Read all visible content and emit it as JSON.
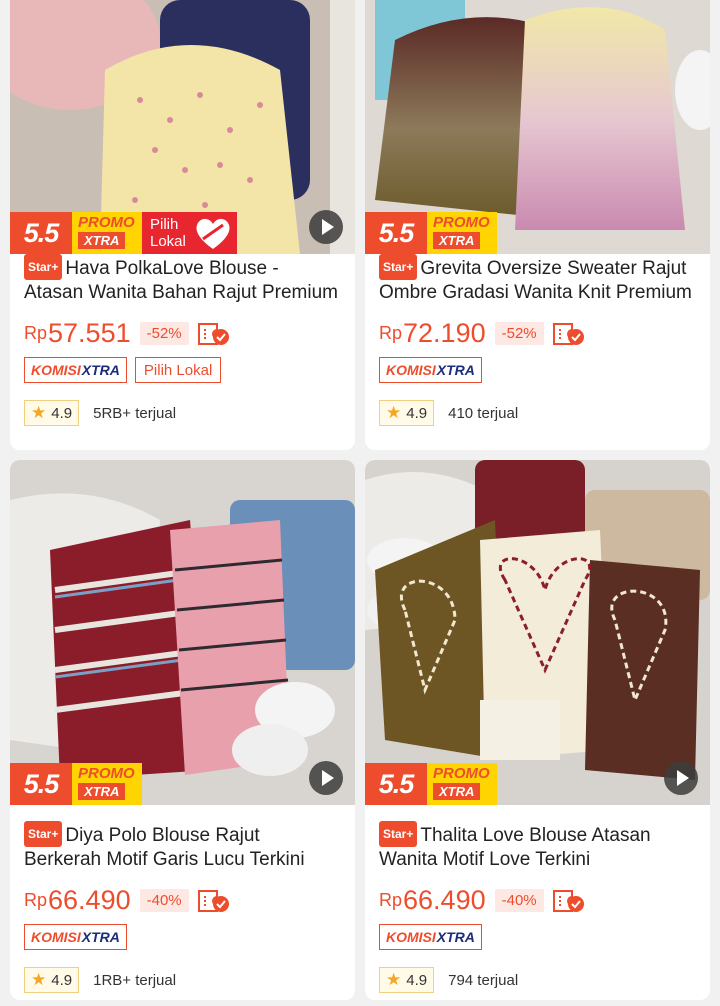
{
  "colors": {
    "accent": "#ee4d2d",
    "promo_yellow": "#ffd400",
    "komisi_blue": "#1b2d7a"
  },
  "products": [
    {
      "badge_55": "5.5",
      "promo_top": "PROMO",
      "promo_bottom": "XTRA",
      "lokal_badge_line1": "Pilih",
      "lokal_badge_line2": "Lokal",
      "star_tag": "Star+",
      "title": "Hava PolkaLove Blouse - Atasan Wanita Bahan Rajut Premium",
      "currency": "Rp",
      "price": "57.551",
      "discount": "-52%",
      "komisi_a": "KOMISI",
      "komisi_b": "XTRA",
      "lokal_tag": "Pilih Lokal",
      "rating": "4.9",
      "sold": "5RB+ terjual"
    },
    {
      "badge_55": "5.5",
      "promo_top": "PROMO",
      "promo_bottom": "XTRA",
      "star_tag": "Star+",
      "title": "Grevita Oversize Sweater Rajut Ombre Gradasi Wanita Knit Premium",
      "currency": "Rp",
      "price": "72.190",
      "discount": "-52%",
      "komisi_a": "KOMISI",
      "komisi_b": "XTRA",
      "rating": "4.9",
      "sold": "410 terjual"
    },
    {
      "badge_55": "5.5",
      "promo_top": "PROMO",
      "promo_bottom": "XTRA",
      "star_tag": "Star+",
      "title": "Diya Polo Blouse Rajut Berkerah Motif Garis Lucu Terkini",
      "currency": "Rp",
      "price": "66.490",
      "discount": "-40%",
      "komisi_a": "KOMISI",
      "komisi_b": "XTRA",
      "rating": "4.9",
      "sold": "1RB+ terjual"
    },
    {
      "badge_55": "5.5",
      "promo_top": "PROMO",
      "promo_bottom": "XTRA",
      "star_tag": "Star+",
      "title": "Thalita Love Blouse Atasan Wanita Motif Love Terkini",
      "currency": "Rp",
      "price": "66.490",
      "discount": "-40%",
      "komisi_a": "KOMISI",
      "komisi_b": "XTRA",
      "rating": "4.9",
      "sold": "794 terjual"
    }
  ]
}
